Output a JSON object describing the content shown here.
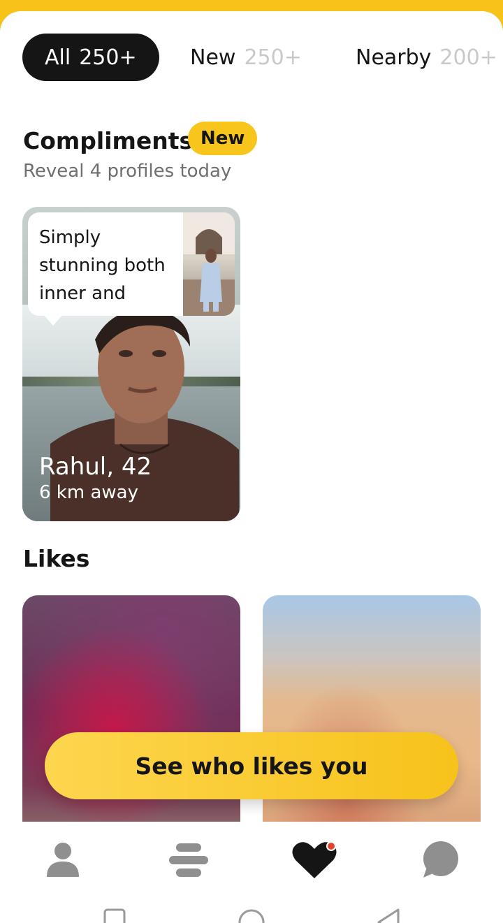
{
  "tabs": [
    {
      "label": "All",
      "count": "250+"
    },
    {
      "label": "New",
      "count": "250+"
    },
    {
      "label": "Nearby",
      "count": "200+"
    }
  ],
  "compliments": {
    "title": "Compliments",
    "badge": "New",
    "subtitle": "Reveal 4 profiles today",
    "card": {
      "message": "Simply stunning both inner and",
      "name": "Rahul, 42",
      "distance": "6 km away"
    }
  },
  "likes": {
    "title": "Likes",
    "cta": "See who likes you"
  },
  "nav": {
    "items": [
      "profile-icon",
      "discover-icon",
      "liked-you-icon",
      "chats-icon"
    ],
    "notification_color": "#e0452b"
  },
  "colors": {
    "accent": "#f8c51c",
    "dark": "#151515"
  }
}
